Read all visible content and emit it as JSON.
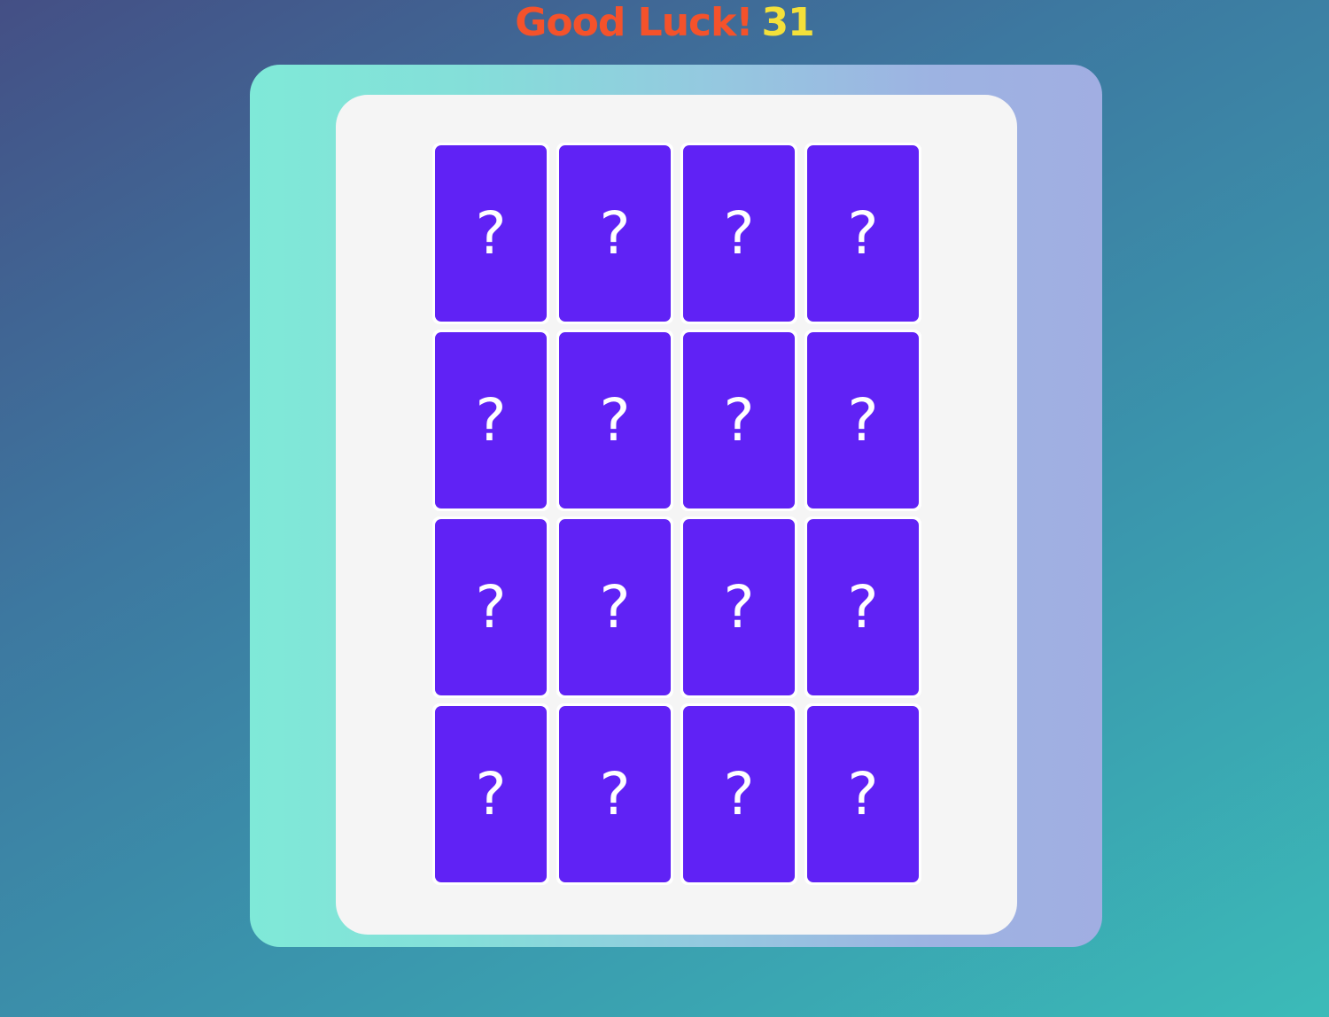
{
  "header": {
    "message": "Good Luck!",
    "counter": "31"
  },
  "colors": {
    "message": "#f4522b",
    "counter": "#f4e03a",
    "card_back": "#6022f5",
    "board": "#f5f5f5"
  },
  "cards": [
    {
      "label": "?",
      "icon": "question-mark-icon"
    },
    {
      "label": "?",
      "icon": "question-mark-icon"
    },
    {
      "label": "?",
      "icon": "question-mark-icon"
    },
    {
      "label": "?",
      "icon": "question-mark-icon"
    },
    {
      "label": "?",
      "icon": "question-mark-icon"
    },
    {
      "label": "?",
      "icon": "question-mark-icon"
    },
    {
      "label": "?",
      "icon": "question-mark-icon"
    },
    {
      "label": "?",
      "icon": "question-mark-icon"
    },
    {
      "label": "?",
      "icon": "question-mark-icon"
    },
    {
      "label": "?",
      "icon": "question-mark-icon"
    },
    {
      "label": "?",
      "icon": "question-mark-icon"
    },
    {
      "label": "?",
      "icon": "question-mark-icon"
    },
    {
      "label": "?",
      "icon": "question-mark-icon"
    },
    {
      "label": "?",
      "icon": "question-mark-icon"
    },
    {
      "label": "?",
      "icon": "question-mark-icon"
    },
    {
      "label": "?",
      "icon": "question-mark-icon"
    }
  ]
}
